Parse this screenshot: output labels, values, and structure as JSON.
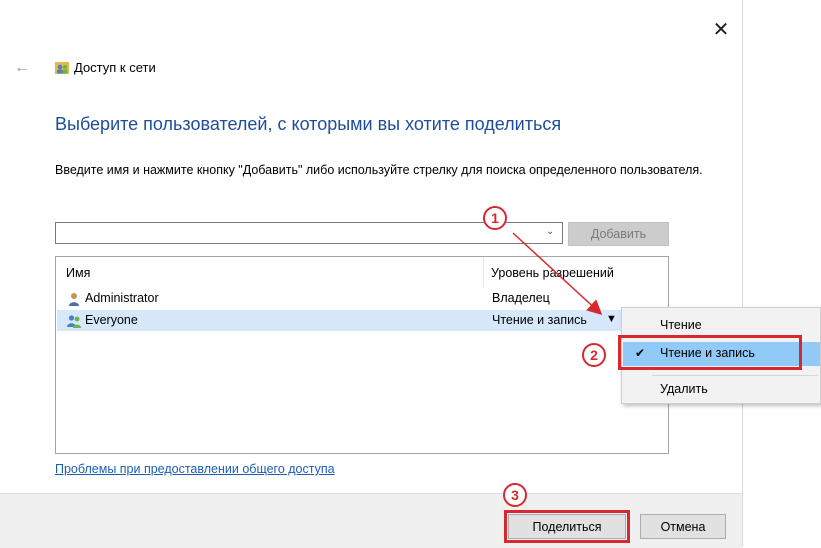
{
  "window": {
    "title": "Доступ к сети",
    "close_icon": "close-icon",
    "back_icon": "back-arrow-icon"
  },
  "heading": "Выберите пользователей, с которыми вы хотите поделиться",
  "instruction": "Введите имя и нажмите кнопку \"Добавить\" либо используйте стрелку для поиска определенного пользователя.",
  "name_input": {
    "value": "",
    "placeholder": ""
  },
  "add_button": "Добавить",
  "list": {
    "columns": [
      "Имя",
      "Уровень разрешений"
    ],
    "rows": [
      {
        "name": "Administrator",
        "permission": "Владелец",
        "icon": "user-icon"
      },
      {
        "name": "Everyone",
        "permission": "Чтение и запись",
        "icon": "users-group-icon",
        "selected": true
      }
    ]
  },
  "menu": {
    "items": [
      {
        "label": "Чтение",
        "checked": false
      },
      {
        "label": "Чтение и запись",
        "checked": true
      },
      {
        "label": "Удалить",
        "checked": false
      }
    ]
  },
  "troubleshoot_link": "Проблемы при предоставлении общего доступа",
  "footer": {
    "share_button": "Поделиться",
    "cancel_button": "Отмена"
  },
  "annotations": [
    "1",
    "2",
    "3"
  ],
  "colors": {
    "heading": "#1e4d9b",
    "link": "#1a5fb4",
    "annotation": "#d7282f",
    "selected_row": "#d8e8fb",
    "menu_highlight": "#91c9f7"
  }
}
